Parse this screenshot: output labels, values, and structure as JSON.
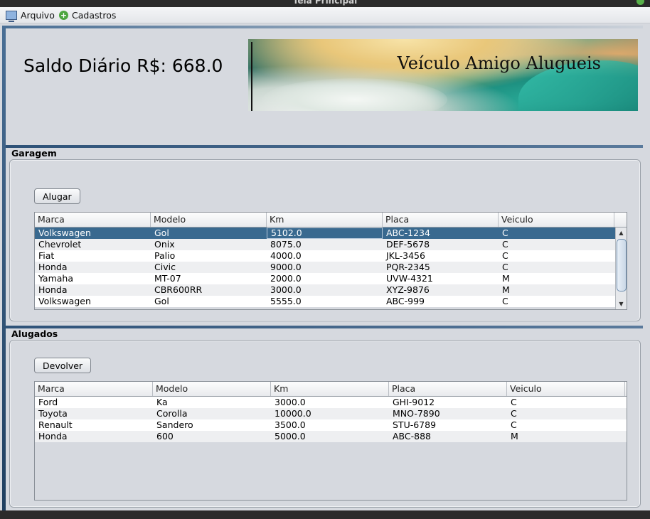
{
  "window": {
    "title": "Tela Principal"
  },
  "menu": {
    "items": [
      {
        "label": "Arquivo",
        "icon": "computer-icon"
      },
      {
        "label": "Cadastros",
        "icon": "plus-icon"
      }
    ]
  },
  "header": {
    "saldo": "Saldo Diário R$: 668.0",
    "banner_title": "Veículo Amigo Alugueis"
  },
  "garagem": {
    "title": "Garagem",
    "button": "Alugar",
    "columns": [
      "Marca",
      "Modelo",
      "Km",
      "Placa",
      "Veiculo"
    ],
    "rows": [
      [
        "Volkswagen",
        "Gol",
        "5102.0",
        "ABC-1234",
        "C"
      ],
      [
        "Chevrolet",
        "Onix",
        "8075.0",
        "DEF-5678",
        "C"
      ],
      [
        "Fiat",
        "Palio",
        "4000.0",
        "JKL-3456",
        "C"
      ],
      [
        "Honda",
        "Civic",
        "9000.0",
        "PQR-2345",
        "C"
      ],
      [
        "Yamaha",
        "MT-07",
        "2000.0",
        "UVW-4321",
        "M"
      ],
      [
        "Honda",
        "CBR600RR",
        "3000.0",
        "XYZ-9876",
        "M"
      ],
      [
        "Volkswagen",
        "Gol",
        "5555.0",
        "ABC-999",
        "C"
      ]
    ],
    "selected_row": 0
  },
  "alugados": {
    "title": "Alugados",
    "button": "Devolver",
    "columns": [
      "Marca",
      "Modelo",
      "Km",
      "Placa",
      "Veiculo"
    ],
    "rows": [
      [
        "Ford",
        "Ka",
        "3000.0",
        "GHI-9012",
        "C"
      ],
      [
        "Toyota",
        "Corolla",
        "10000.0",
        "MNO-7890",
        "C"
      ],
      [
        "Renault",
        "Sandero",
        "3500.0",
        "STU-6789",
        "C"
      ],
      [
        "Honda",
        "600",
        "5000.0",
        "ABC-888",
        "M"
      ]
    ]
  },
  "colors": {
    "selection": "#39698f",
    "accent_bar": "#2e5278",
    "background": "#d6d9df"
  }
}
